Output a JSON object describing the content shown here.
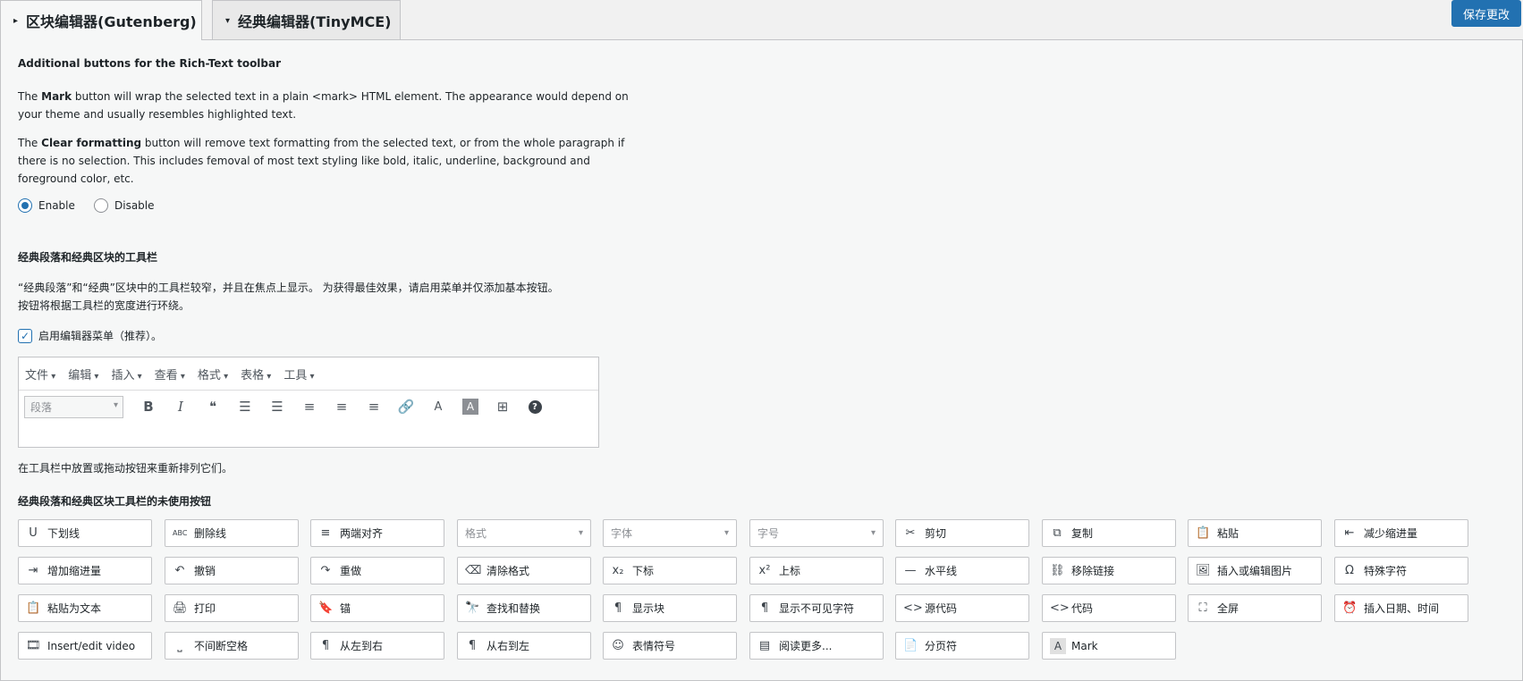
{
  "tabs": [
    {
      "label": "区块编辑器(Gutenberg)",
      "indicator": "▸",
      "active": true
    },
    {
      "label": "经典编辑器(TinyMCE)",
      "indicator": "▾",
      "active": false
    }
  ],
  "save_button": "保存更改",
  "rich_text": {
    "heading": "Additional buttons for the Rich-Text toolbar",
    "mark_desc": {
      "pre": "The ",
      "bold": "Mark",
      "post": " button will wrap the selected text in a plain <mark> HTML element. The appearance would depend on",
      "line2": "your theme and usually resembles highlighted text."
    },
    "clear_desc": {
      "pre": "The ",
      "bold": "Clear formatting",
      "post": " button will remove text formatting from the selected text, or from the whole paragraph if",
      "line2": "there is no selection. This includes femoval of most text styling like bold, italic, underline, background and",
      "line3": "foreground color, etc."
    },
    "options": [
      {
        "label": "Enable",
        "checked": true
      },
      {
        "label": "Disable",
        "checked": false
      }
    ]
  },
  "classic": {
    "heading": "经典段落和经典区块的工具栏",
    "desc1": "“经典段落”和“经典”区块中的工具栏较窄，并且在焦点上显示。 为获得最佳效果，请启用菜单并仅添加基本按钮。",
    "desc2": "按钮将根据工具栏的宽度进行环绕。",
    "menu_checkbox": {
      "label": "启用编辑器菜单（推荐）。",
      "checked": true
    }
  },
  "editor": {
    "menus": [
      "文件",
      "编辑",
      "插入",
      "查看",
      "格式",
      "表格",
      "工具"
    ],
    "format_select": "段落",
    "toolbar": [
      {
        "name": "bold-icon",
        "glyph": "B"
      },
      {
        "name": "italic-icon",
        "glyph": "I"
      },
      {
        "name": "blockquote-icon",
        "glyph": "❝"
      },
      {
        "name": "bullet-list-icon",
        "glyph": "☰"
      },
      {
        "name": "numbered-list-icon",
        "glyph": "☰"
      },
      {
        "name": "align-left-icon",
        "glyph": "≡"
      },
      {
        "name": "align-center-icon",
        "glyph": "≡"
      },
      {
        "name": "align-right-icon",
        "glyph": "≡"
      },
      {
        "name": "link-icon",
        "glyph": "🔗"
      },
      {
        "name": "text-color-icon",
        "glyph": "A"
      },
      {
        "name": "background-color-icon",
        "glyph": "A"
      },
      {
        "name": "table-icon",
        "glyph": "⊞"
      },
      {
        "name": "help-icon",
        "glyph": "?"
      }
    ]
  },
  "drag_hint": "在工具栏中放置或拖动按钮来重新排列它们。",
  "unused_heading": "经典段落和经典区块工具栏的未使用按钮",
  "unused_buttons": [
    {
      "label": "下划线",
      "icon": "U",
      "icon_name": "underline-icon"
    },
    {
      "label": "删除线",
      "icon": "ABC",
      "icon_name": "strikethrough-icon"
    },
    {
      "label": "两端对齐",
      "icon": "≡",
      "icon_name": "justify-icon"
    },
    {
      "label": "格式",
      "icon": "",
      "icon_name": "",
      "select": true
    },
    {
      "label": "字体",
      "icon": "",
      "icon_name": "",
      "select": true
    },
    {
      "label": "字号",
      "icon": "",
      "icon_name": "",
      "select": true
    },
    {
      "label": "剪切",
      "icon": "✂",
      "icon_name": "scissors-icon"
    },
    {
      "label": "复制",
      "icon": "⧉",
      "icon_name": "copy-icon"
    },
    {
      "label": "粘贴",
      "icon": "📋",
      "icon_name": "paste-icon"
    },
    {
      "label": "减少缩进量",
      "icon": "⇤",
      "icon_name": "outdent-icon"
    },
    {
      "label": "增加缩进量",
      "icon": "⇥",
      "icon_name": "indent-icon"
    },
    {
      "label": "撤销",
      "icon": "↶",
      "icon_name": "undo-icon"
    },
    {
      "label": "重做",
      "icon": "↷",
      "icon_name": "redo-icon"
    },
    {
      "label": "清除格式",
      "icon": "⌫",
      "icon_name": "eraser-icon"
    },
    {
      "label": "下标",
      "icon": "x₂",
      "icon_name": "subscript-icon"
    },
    {
      "label": "上标",
      "icon": "x²",
      "icon_name": "superscript-icon"
    },
    {
      "label": "水平线",
      "icon": "—",
      "icon_name": "horizontal-rule-icon"
    },
    {
      "label": "移除链接",
      "icon": "⛓",
      "icon_name": "unlink-icon"
    },
    {
      "label": "插入或编辑图片",
      "icon": "🖼",
      "icon_name": "image-icon"
    },
    {
      "label": "特殊字符",
      "icon": "Ω",
      "icon_name": "omega-icon"
    },
    {
      "label": "粘贴为文本",
      "icon": "📋",
      "icon_name": "paste-text-icon"
    },
    {
      "label": "打印",
      "icon": "🖨",
      "icon_name": "print-icon"
    },
    {
      "label": "锚",
      "icon": "🔖",
      "icon_name": "bookmark-icon"
    },
    {
      "label": "查找和替换",
      "icon": "🔭",
      "icon_name": "binoculars-icon"
    },
    {
      "label": "显示块",
      "icon": "¶",
      "icon_name": "pilcrow-icon"
    },
    {
      "label": "显示不可见字符",
      "icon": "¶",
      "icon_name": "invisible-chars-icon"
    },
    {
      "label": "源代码",
      "icon": "<>",
      "icon_name": "source-code-icon"
    },
    {
      "label": "代码",
      "icon": "<>",
      "icon_name": "code-icon"
    },
    {
      "label": "全屏",
      "icon": "⛶",
      "icon_name": "fullscreen-icon"
    },
    {
      "label": "插入日期、时间",
      "icon": "⏰",
      "icon_name": "clock-icon"
    },
    {
      "label": "Insert/edit video",
      "icon": "🎞",
      "icon_name": "video-icon"
    },
    {
      "label": "不间断空格",
      "icon": "⎵",
      "icon_name": "nbsp-icon"
    },
    {
      "label": "从左到右",
      "icon": "¶",
      "icon_name": "ltr-icon"
    },
    {
      "label": "从右到左",
      "icon": "¶",
      "icon_name": "rtl-icon"
    },
    {
      "label": "表情符号",
      "icon": "☺",
      "icon_name": "emoji-icon"
    },
    {
      "label": "阅读更多...",
      "icon": "▤",
      "icon_name": "read-more-icon"
    },
    {
      "label": "分页符",
      "icon": "📄",
      "icon_name": "page-break-icon"
    },
    {
      "label": "Mark",
      "icon": "A",
      "icon_name": "mark-icon",
      "mark": true
    }
  ]
}
